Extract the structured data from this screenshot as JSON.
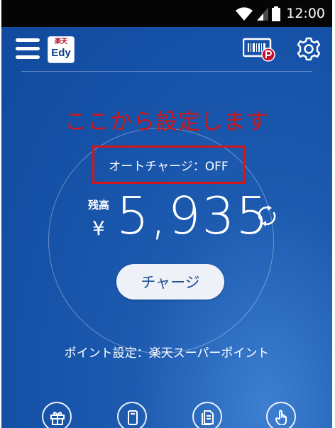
{
  "status_bar": {
    "time": "12:00",
    "icons": [
      "wifi-icon",
      "signal-icon",
      "battery-icon"
    ]
  },
  "header": {
    "logo_top": "楽天",
    "logo_bottom": "Edy",
    "icons": [
      "menu-icon",
      "barcode-point-icon",
      "gear-icon"
    ]
  },
  "annotation": "ここから設定します",
  "main": {
    "auto_charge": "オートチャージ：OFF",
    "balance_label": "残高",
    "currency": "¥",
    "balance": "5,935",
    "charge_button": "チャージ",
    "point_setting": "ポイント設定：楽天スーパーポイント"
  },
  "bottom_nav": {
    "icons": [
      "gift-icon",
      "phone-card-icon",
      "document-icon",
      "hand-icon"
    ]
  },
  "colors": {
    "background": "#1450a6",
    "annotation_red": "#d31616",
    "button_bg": "#eef2f8",
    "button_text": "#1e4f95"
  }
}
